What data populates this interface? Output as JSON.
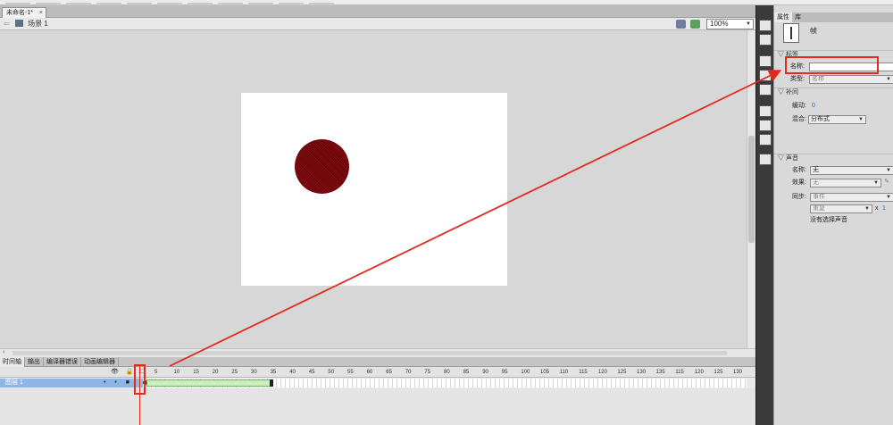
{
  "document": {
    "tab_title": "未命名-1*",
    "tab_close": "×",
    "scene_label": "场景 1",
    "zoom": "100%"
  },
  "timeline": {
    "tabs": [
      "时间轴",
      "输出",
      "编译器错误",
      "动画编辑器"
    ],
    "active_tab": 0,
    "ruler": [
      "5",
      "10",
      "15",
      "20",
      "25",
      "30",
      "35",
      "40",
      "45",
      "50",
      "55",
      "60",
      "65",
      "70",
      "75",
      "80",
      "85",
      "90",
      "95",
      "100",
      "105",
      "110",
      "115",
      "120",
      "125",
      "130",
      "135",
      "115",
      "120",
      "125",
      "130"
    ],
    "current_frame": "1",
    "layer_name": "图层 1",
    "layer_marks": "• • ■"
  },
  "properties": {
    "tabs": [
      "属性",
      "库"
    ],
    "active_tab": 0,
    "object_type": "帧",
    "label_section": "标签",
    "name_label": "名称:",
    "name_value": "",
    "type_label": "类型:",
    "type_value": "名称",
    "tween_section": "补间",
    "ease_label": "缓动:",
    "ease_value": "0",
    "blend_label": "混合:",
    "blend_value": "分布式",
    "sound_section": "声音",
    "sound_name_label": "名称:",
    "sound_name_value": "无",
    "effect_label": "效果:",
    "effect_value": "无",
    "sync_label": "同步:",
    "sync_value": "事件",
    "repeat_value": "重复",
    "repeat_x": "x",
    "repeat_count": "1",
    "no_sound_text": "没有选择声音"
  },
  "colors": {
    "annotation": "#e32a1d",
    "shape_fill": "#8c0c12",
    "selected_layer": "#8fb7e6",
    "tween_span": "#c8f0bd"
  }
}
